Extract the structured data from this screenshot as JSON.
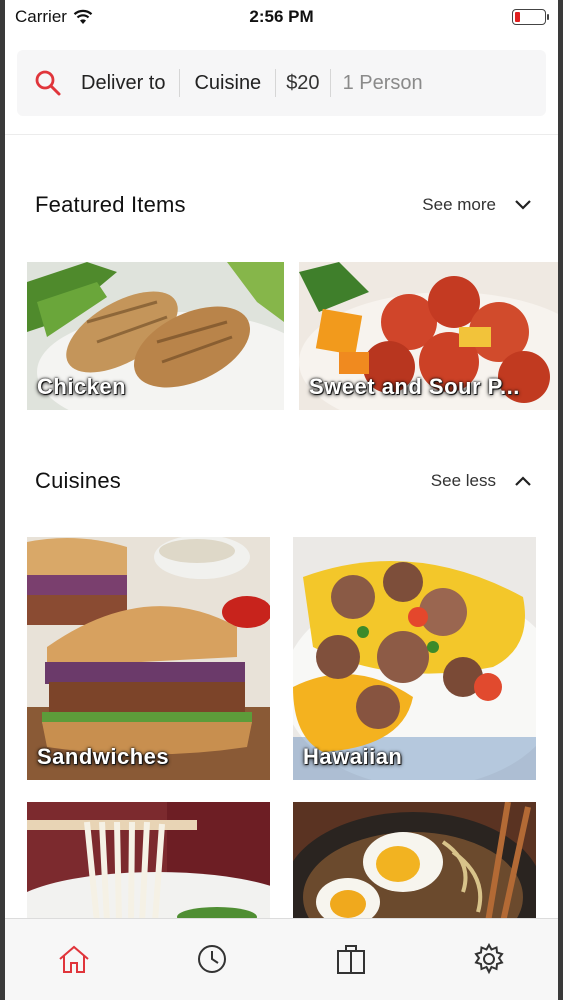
{
  "status": {
    "carrier": "Carrier",
    "time": "2:56 PM"
  },
  "search": {
    "deliver": "Deliver to",
    "cuisine": "Cuisine",
    "price": "$20",
    "people": "1 Person"
  },
  "featured": {
    "title": "Featured Items",
    "action": "See more",
    "items": [
      {
        "label": "Chicken"
      },
      {
        "label": "Sweet and Sour P..."
      }
    ]
  },
  "cuisines": {
    "title": "Cuisines",
    "action": "See less",
    "items": [
      {
        "label": "Sandwiches"
      },
      {
        "label": "Hawaiian"
      },
      {
        "label": ""
      },
      {
        "label": ""
      }
    ]
  },
  "tabs": [
    "home-icon",
    "clock-icon",
    "bag-icon",
    "gear-icon"
  ],
  "colors": {
    "accent": "#e0353b",
    "inactive": "#333333"
  }
}
